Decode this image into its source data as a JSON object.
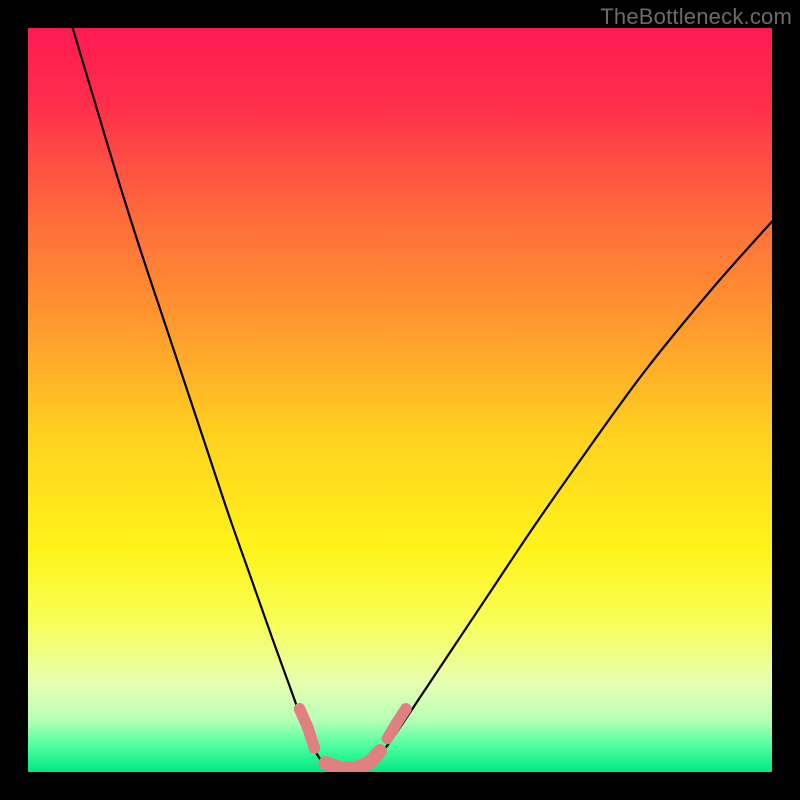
{
  "watermark": "TheBottleneck.com",
  "chart_data": {
    "type": "line",
    "title": "",
    "xlabel": "",
    "ylabel": "",
    "xlim": [
      0,
      100
    ],
    "ylim": [
      0,
      100
    ],
    "grid": false,
    "legend": false,
    "background_gradient_stops": [
      {
        "offset": 0.0,
        "color": "#ff1a52"
      },
      {
        "offset": 0.1,
        "color": "#ff2e4c"
      },
      {
        "offset": 0.25,
        "color": "#ff6a3a"
      },
      {
        "offset": 0.4,
        "color": "#ff9a2e"
      },
      {
        "offset": 0.55,
        "color": "#ffd21f"
      },
      {
        "offset": 0.7,
        "color": "#fff31a"
      },
      {
        "offset": 0.8,
        "color": "#f7ff58"
      },
      {
        "offset": 0.88,
        "color": "#e7ffb0"
      },
      {
        "offset": 0.93,
        "color": "#b7ffb7"
      },
      {
        "offset": 0.965,
        "color": "#4dff9f"
      },
      {
        "offset": 1.0,
        "color": "#00e884"
      }
    ],
    "series": [
      {
        "name": "bottleneck-curve",
        "stroke": "#000000",
        "stroke_width": 2.2,
        "points": [
          {
            "x": 6.0,
            "y": 100.0
          },
          {
            "x": 9.0,
            "y": 90.0
          },
          {
            "x": 12.0,
            "y": 80.0
          },
          {
            "x": 15.0,
            "y": 70.5
          },
          {
            "x": 18.0,
            "y": 61.5
          },
          {
            "x": 21.0,
            "y": 52.5
          },
          {
            "x": 24.0,
            "y": 43.5
          },
          {
            "x": 27.0,
            "y": 34.5
          },
          {
            "x": 30.0,
            "y": 26.0
          },
          {
            "x": 33.0,
            "y": 17.5
          },
          {
            "x": 35.0,
            "y": 12.0
          },
          {
            "x": 37.0,
            "y": 6.5
          },
          {
            "x": 38.5,
            "y": 3.0
          },
          {
            "x": 40.0,
            "y": 1.0
          },
          {
            "x": 42.0,
            "y": 0.3
          },
          {
            "x": 44.0,
            "y": 0.3
          },
          {
            "x": 46.0,
            "y": 1.2
          },
          {
            "x": 48.0,
            "y": 3.2
          },
          {
            "x": 50.0,
            "y": 6.0
          },
          {
            "x": 53.0,
            "y": 10.5
          },
          {
            "x": 57.0,
            "y": 16.5
          },
          {
            "x": 62.0,
            "y": 24.0
          },
          {
            "x": 68.0,
            "y": 33.0
          },
          {
            "x": 75.0,
            "y": 43.0
          },
          {
            "x": 83.0,
            "y": 54.0
          },
          {
            "x": 92.0,
            "y": 65.0
          },
          {
            "x": 100.0,
            "y": 74.0
          }
        ]
      },
      {
        "name": "optimum-markers",
        "stroke": "#e08080",
        "stroke_width": 14,
        "linecap": "round",
        "points": [
          {
            "x": 36.5,
            "y": 8.5
          },
          {
            "x": 37.6,
            "y": 6.0
          },
          {
            "x": 38.5,
            "y": 3.2
          },
          {
            "x": 40.0,
            "y": 1.2
          },
          {
            "x": 42.0,
            "y": 0.5
          },
          {
            "x": 44.0,
            "y": 0.5
          },
          {
            "x": 45.8,
            "y": 1.2
          },
          {
            "x": 47.3,
            "y": 2.8
          },
          {
            "x": 48.3,
            "y": 4.5
          },
          {
            "x": 49.5,
            "y": 6.5
          },
          {
            "x": 50.8,
            "y": 8.5
          }
        ]
      }
    ]
  }
}
